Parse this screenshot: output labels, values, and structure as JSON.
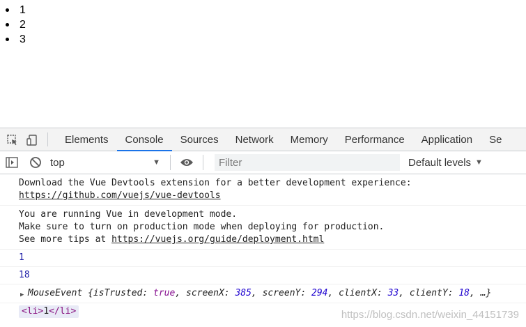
{
  "page": {
    "list_items": [
      "1",
      "2",
      "3"
    ]
  },
  "devtools": {
    "tabs": [
      "Elements",
      "Console",
      "Sources",
      "Network",
      "Memory",
      "Performance",
      "Application",
      "Se"
    ],
    "active_tab": "Console",
    "context_value": "top",
    "filter_placeholder": "Filter",
    "levels_label": "Default levels"
  },
  "console": {
    "devtools_msg_line1": "Download the Vue Devtools extension for a better development experience:",
    "devtools_msg_link": "https://github.com/vuejs/vue-devtools",
    "vue_msg_line1": "You are running Vue in development mode.",
    "vue_msg_line2": "Make sure to turn on production mode when deploying for production.",
    "vue_msg_line3_prefix": "See more tips at ",
    "vue_msg_link": "https://vuejs.org/guide/deployment.html",
    "log_1": "1",
    "log_2": "18",
    "event": {
      "name": "MouseEvent",
      "isTrusted": "true",
      "screenX": "385",
      "screenY": "294",
      "clientX": "33",
      "clientY": "18"
    },
    "element": {
      "open_tag": "<li>",
      "text": "1",
      "close_tag": "</li>"
    }
  },
  "watermark": "https://blog.csdn.net/weixin_44151739",
  "colors": {
    "accent": "#1a73e8",
    "number": "#1a1aa6",
    "keyword": "#881391"
  }
}
